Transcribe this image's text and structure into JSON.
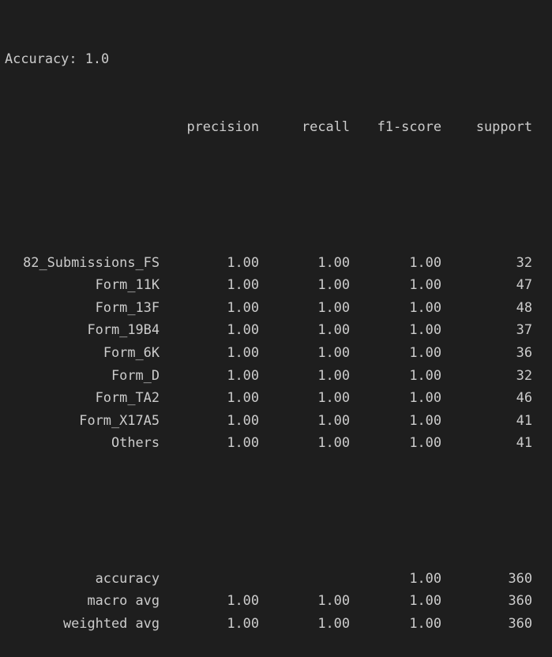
{
  "accuracy_line": "Accuracy: 1.0",
  "headers": {
    "precision": "precision",
    "recall": "recall",
    "f1": "f1-score",
    "support": "support"
  },
  "rows": [
    {
      "label": "82_Submissions_FS",
      "precision": "1.00",
      "recall": "1.00",
      "f1": "1.00",
      "support": "32"
    },
    {
      "label": "Form_11K",
      "precision": "1.00",
      "recall": "1.00",
      "f1": "1.00",
      "support": "47"
    },
    {
      "label": "Form_13F",
      "precision": "1.00",
      "recall": "1.00",
      "f1": "1.00",
      "support": "48"
    },
    {
      "label": "Form_19B4",
      "precision": "1.00",
      "recall": "1.00",
      "f1": "1.00",
      "support": "37"
    },
    {
      "label": "Form_6K",
      "precision": "1.00",
      "recall": "1.00",
      "f1": "1.00",
      "support": "36"
    },
    {
      "label": "Form_D",
      "precision": "1.00",
      "recall": "1.00",
      "f1": "1.00",
      "support": "32"
    },
    {
      "label": "Form_TA2",
      "precision": "1.00",
      "recall": "1.00",
      "f1": "1.00",
      "support": "46"
    },
    {
      "label": "Form_X17A5",
      "precision": "1.00",
      "recall": "1.00",
      "f1": "1.00",
      "support": "41"
    },
    {
      "label": "Others",
      "precision": "1.00",
      "recall": "1.00",
      "f1": "1.00",
      "support": "41"
    }
  ],
  "summary": [
    {
      "label": "accuracy",
      "precision": "",
      "recall": "",
      "f1": "1.00",
      "support": "360"
    },
    {
      "label": "macro avg",
      "precision": "1.00",
      "recall": "1.00",
      "f1": "1.00",
      "support": "360"
    },
    {
      "label": "weighted avg",
      "precision": "1.00",
      "recall": "1.00",
      "f1": "1.00",
      "support": "360"
    }
  ],
  "colors": {
    "background": "#1e1e1e",
    "text": "#cccccc"
  }
}
